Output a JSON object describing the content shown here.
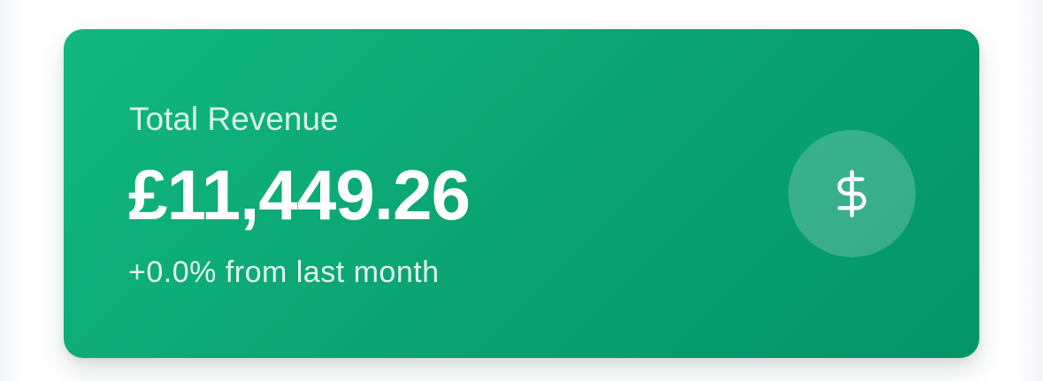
{
  "card": {
    "label": "Total Revenue",
    "value": "£11,449.26",
    "change_text": "+0.0% from last month",
    "icon": "dollar-sign-icon",
    "accent_color": "#0aa472"
  }
}
